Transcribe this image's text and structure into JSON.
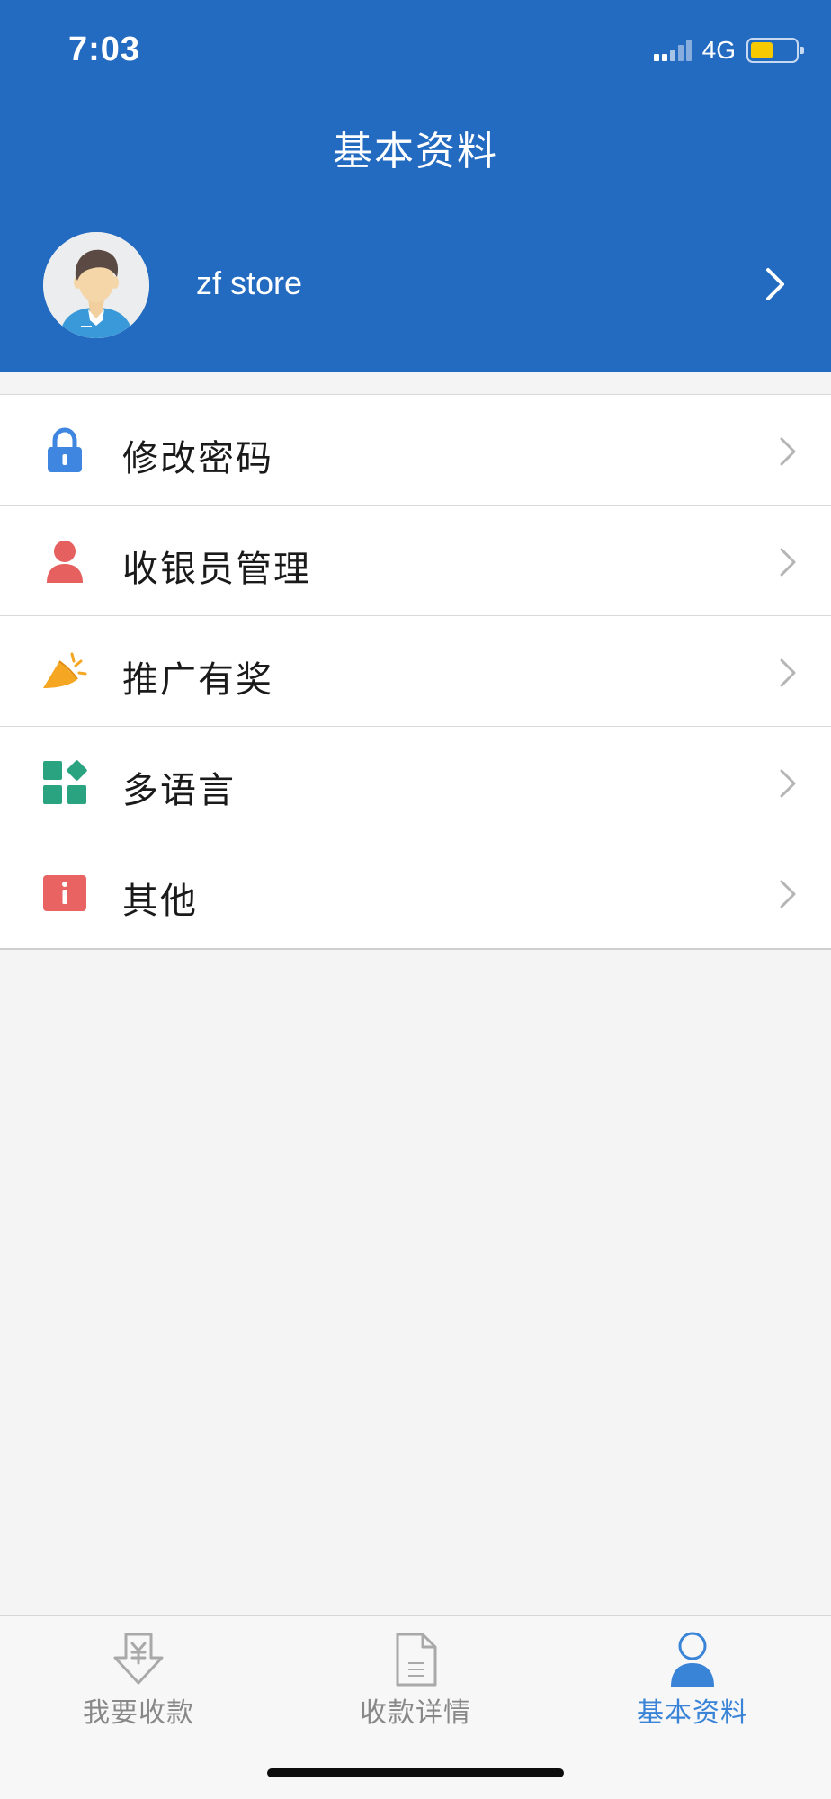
{
  "status_bar": {
    "time": "7:03",
    "network": "4G",
    "battery_level": 0.5
  },
  "header": {
    "title": "基本资料"
  },
  "profile": {
    "store_name": "zf store"
  },
  "menu": {
    "items": [
      {
        "label": "修改密码",
        "icon": "lock-icon",
        "color": "#3f86e0"
      },
      {
        "label": "收银员管理",
        "icon": "user-icon",
        "color": "#e5605e"
      },
      {
        "label": "推广有奖",
        "icon": "megaphone-icon",
        "color": "#f5a623"
      },
      {
        "label": "多语言",
        "icon": "apps-grid-icon",
        "color": "#2aa381"
      },
      {
        "label": "其他",
        "icon": "info-icon",
        "color": "#e96363"
      }
    ]
  },
  "tabbar": {
    "tabs": [
      {
        "label": "我要收款",
        "icon": "yen-download-icon",
        "active": false
      },
      {
        "label": "收款详情",
        "icon": "document-icon",
        "active": false
      },
      {
        "label": "基本资料",
        "icon": "person-icon",
        "active": true
      }
    ]
  },
  "colors": {
    "header": "#236ac1",
    "active_tab": "#3a84d8",
    "inactive_tab": "#888888"
  }
}
